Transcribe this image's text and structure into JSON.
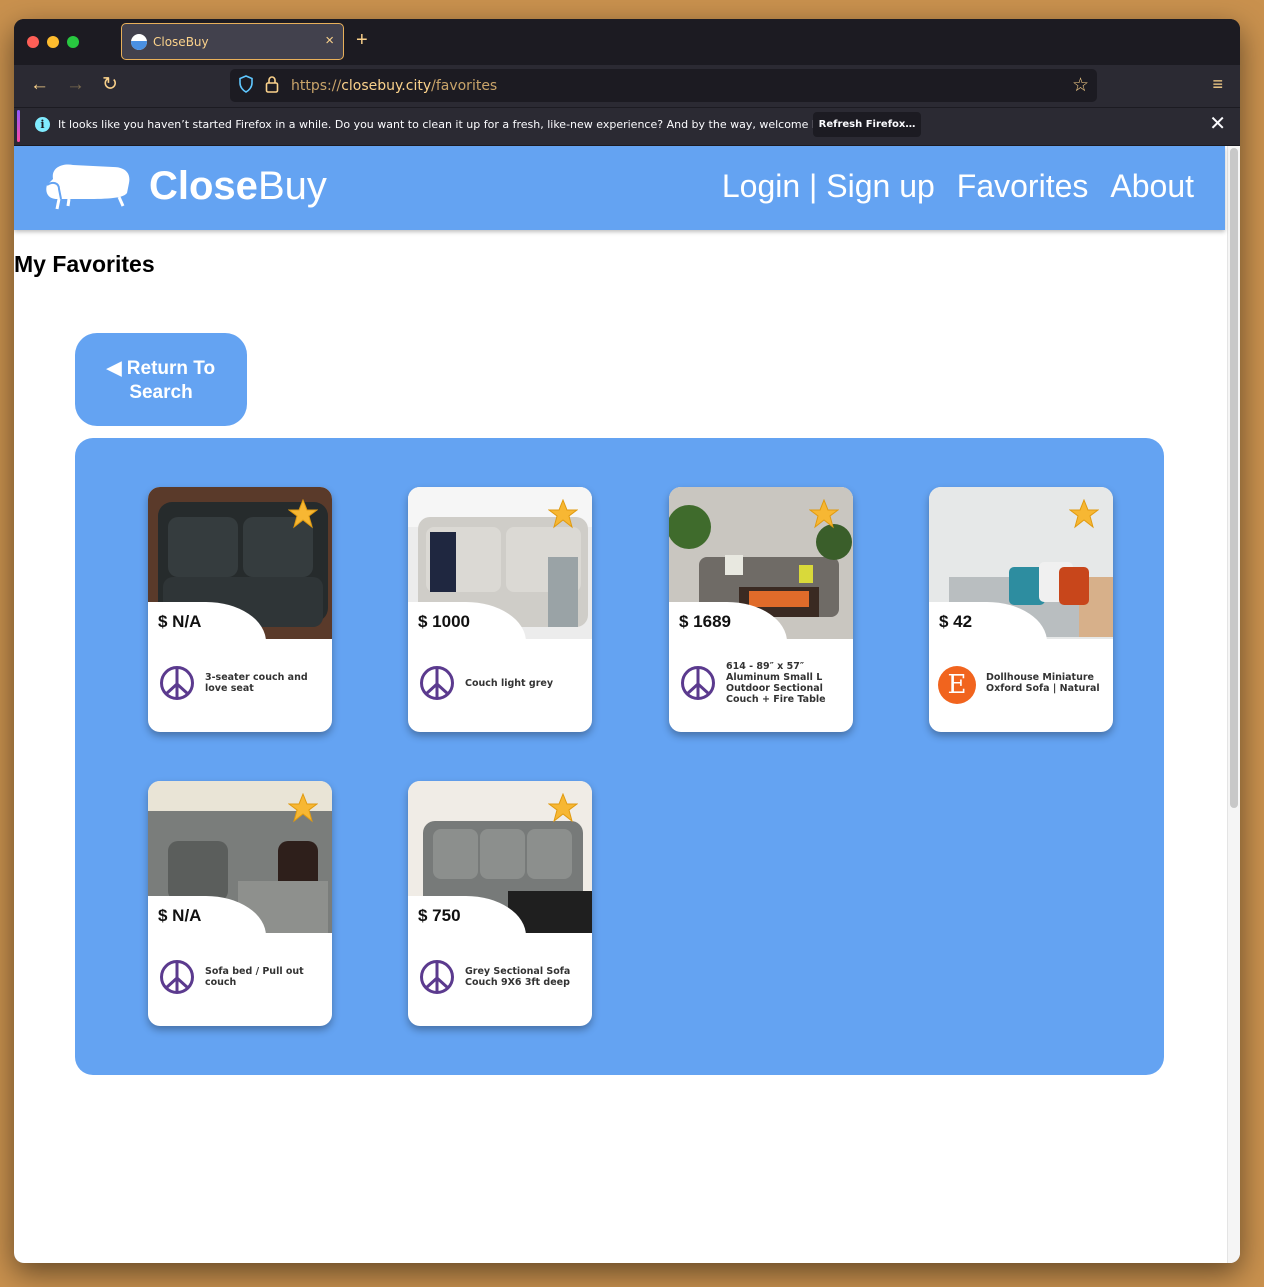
{
  "browser": {
    "tab_title": "CloseBuy",
    "tab_close": "×",
    "new_tab": "+",
    "url_scheme": "https://",
    "url_host": "closebuy.city",
    "url_path": "/favorites",
    "notification_text": "It looks like you haven’t started Firefox in a while. Do you want to clean it up for a fresh, like-new experience? And by the way, welcome back!",
    "notification_button": "Refresh Firefox…",
    "icons": [
      "back-arrow-icon",
      "forward-arrow-icon",
      "reload-icon",
      "shield-icon",
      "lock-icon",
      "bookmark-star-icon",
      "hamburger-menu-icon",
      "info-icon",
      "close-icon"
    ]
  },
  "site": {
    "brand_bold": "Close",
    "brand_light": "Buy",
    "nav": {
      "login": "Login | Sign up",
      "favorites": "Favorites",
      "about": "About"
    },
    "header_color": "#64a3f2"
  },
  "page": {
    "title": "My Favorites",
    "return_button": "◀ Return To Search"
  },
  "favorites": [
    {
      "price": "$ N/A",
      "title": "3-seater couch and love seat",
      "source": "craigslist-peace-icon"
    },
    {
      "price": "$ 1000",
      "title": "Couch light grey",
      "source": "craigslist-peace-icon"
    },
    {
      "price": "$ 1689",
      "title": "614 - 89″ x 57″ Aluminum Small L Outdoor Sectional Couch + Fire Table",
      "source": "craigslist-peace-icon"
    },
    {
      "price": "$ 42",
      "title": "Dollhouse Miniature Oxford Sofa | Natural",
      "source": "etsy-icon",
      "source_letter": "E"
    },
    {
      "price": "$ N/A",
      "title": "Sofa bed / Pull out couch",
      "source": "craigslist-peace-icon"
    },
    {
      "price": "$ 750",
      "title": "Grey Sectional Sofa Couch 9X6 3ft deep",
      "source": "craigslist-peace-icon"
    }
  ]
}
